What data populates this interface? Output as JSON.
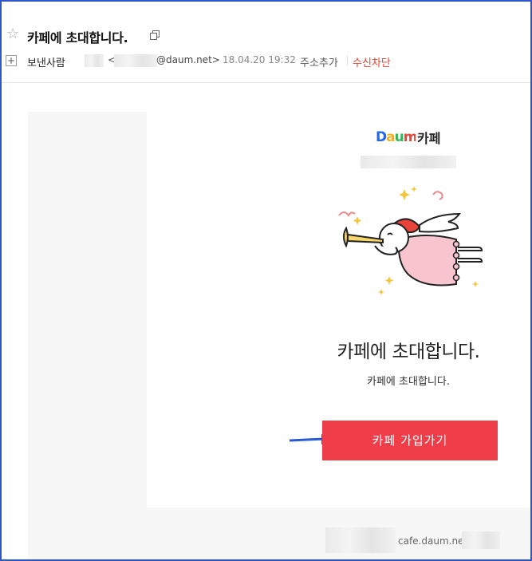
{
  "mail": {
    "subject": "카페에 초대합니다.",
    "sender_label": "보낸사람",
    "sender_lt": "<",
    "sender_email_domain": "@daum.net>",
    "date": "18.04.20 19:32",
    "add_address": "주소추가",
    "block": "수신차단"
  },
  "content": {
    "logo_text": "Daum",
    "logo_cafe": "카페",
    "title": "카페에 초대합니다.",
    "subtitle": "카페에 초대합니다.",
    "join_button": "카페 가입가기",
    "cafe_url": "cafe.daum.net/"
  },
  "colors": {
    "frame_border": "#2d56c9",
    "join_button": "#ef3e4a",
    "block_link": "#e0452f",
    "arrow": "#2a5bd7"
  },
  "icons": [
    "star-icon",
    "copy-icon",
    "plus-icon",
    "angel-illustration",
    "pointer-arrow-icon"
  ]
}
